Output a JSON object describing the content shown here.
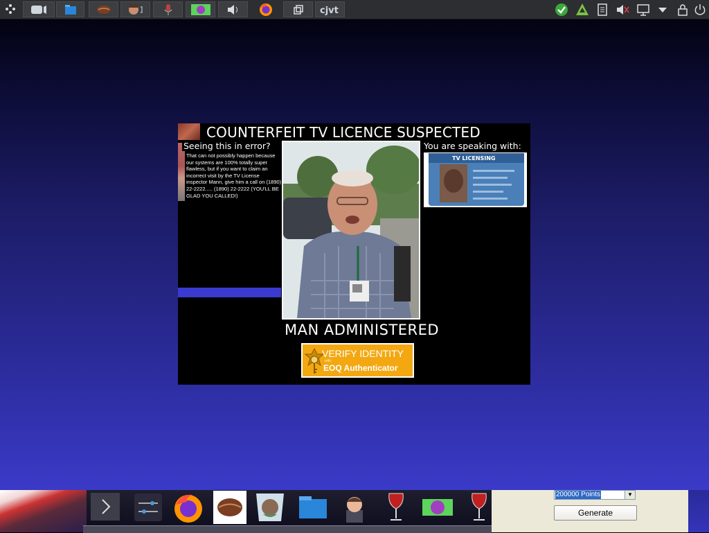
{
  "dialog": {
    "title": "COUNTERFEIT TV LICENCE SUSPECTED",
    "error_heading": "Seeing this in error?",
    "error_body": "That can not possibly happen because our systems are 100% totally super flawless, but if you want to claim an incorrect visit by the TV License inspector Mann, give him a call on (1890) 22-2222..... (1890) 22-2222 (YOU'LL BE GLAD YOU CALLED!)",
    "speaking_heading": "You are speaking with:",
    "caption": "MAN ADMINISTERED",
    "verify_label": "VERIFY IDENTITY",
    "verify_tiny": "with",
    "verify_sub": "EOQ Authenticator",
    "id_card_text": "TV LICENSING"
  },
  "generator": {
    "points_value": "200000 Points",
    "generate_label": "Generate"
  },
  "colors": {
    "accent_orange": "#f3a812",
    "dialog_bg": "#000000",
    "bar_blue": "#3a3ad0"
  },
  "icons": {
    "topbar": [
      "app-menu-icon",
      "media-player-icon",
      "file-manager-icon",
      "coffee-icon",
      "avatar-sound-icon",
      "microphone-icon",
      "game-icon",
      "speaker-icon",
      "firefox-icon",
      "window-icon",
      "cjvt-icon"
    ],
    "tray": [
      "check-icon",
      "triangle-icon",
      "clipboard-icon",
      "volume-muted-icon",
      "network-icon",
      "chevron-down-icon",
      "lock-icon",
      "power-icon"
    ],
    "dock": [
      "chevron-right-icon",
      "settings-sliders-icon",
      "firefox-icon",
      "coffee-icon",
      "avatar-icon",
      "folder-icon",
      "person-icon",
      "wine-icon",
      "game-icon",
      "wine-icon"
    ]
  }
}
